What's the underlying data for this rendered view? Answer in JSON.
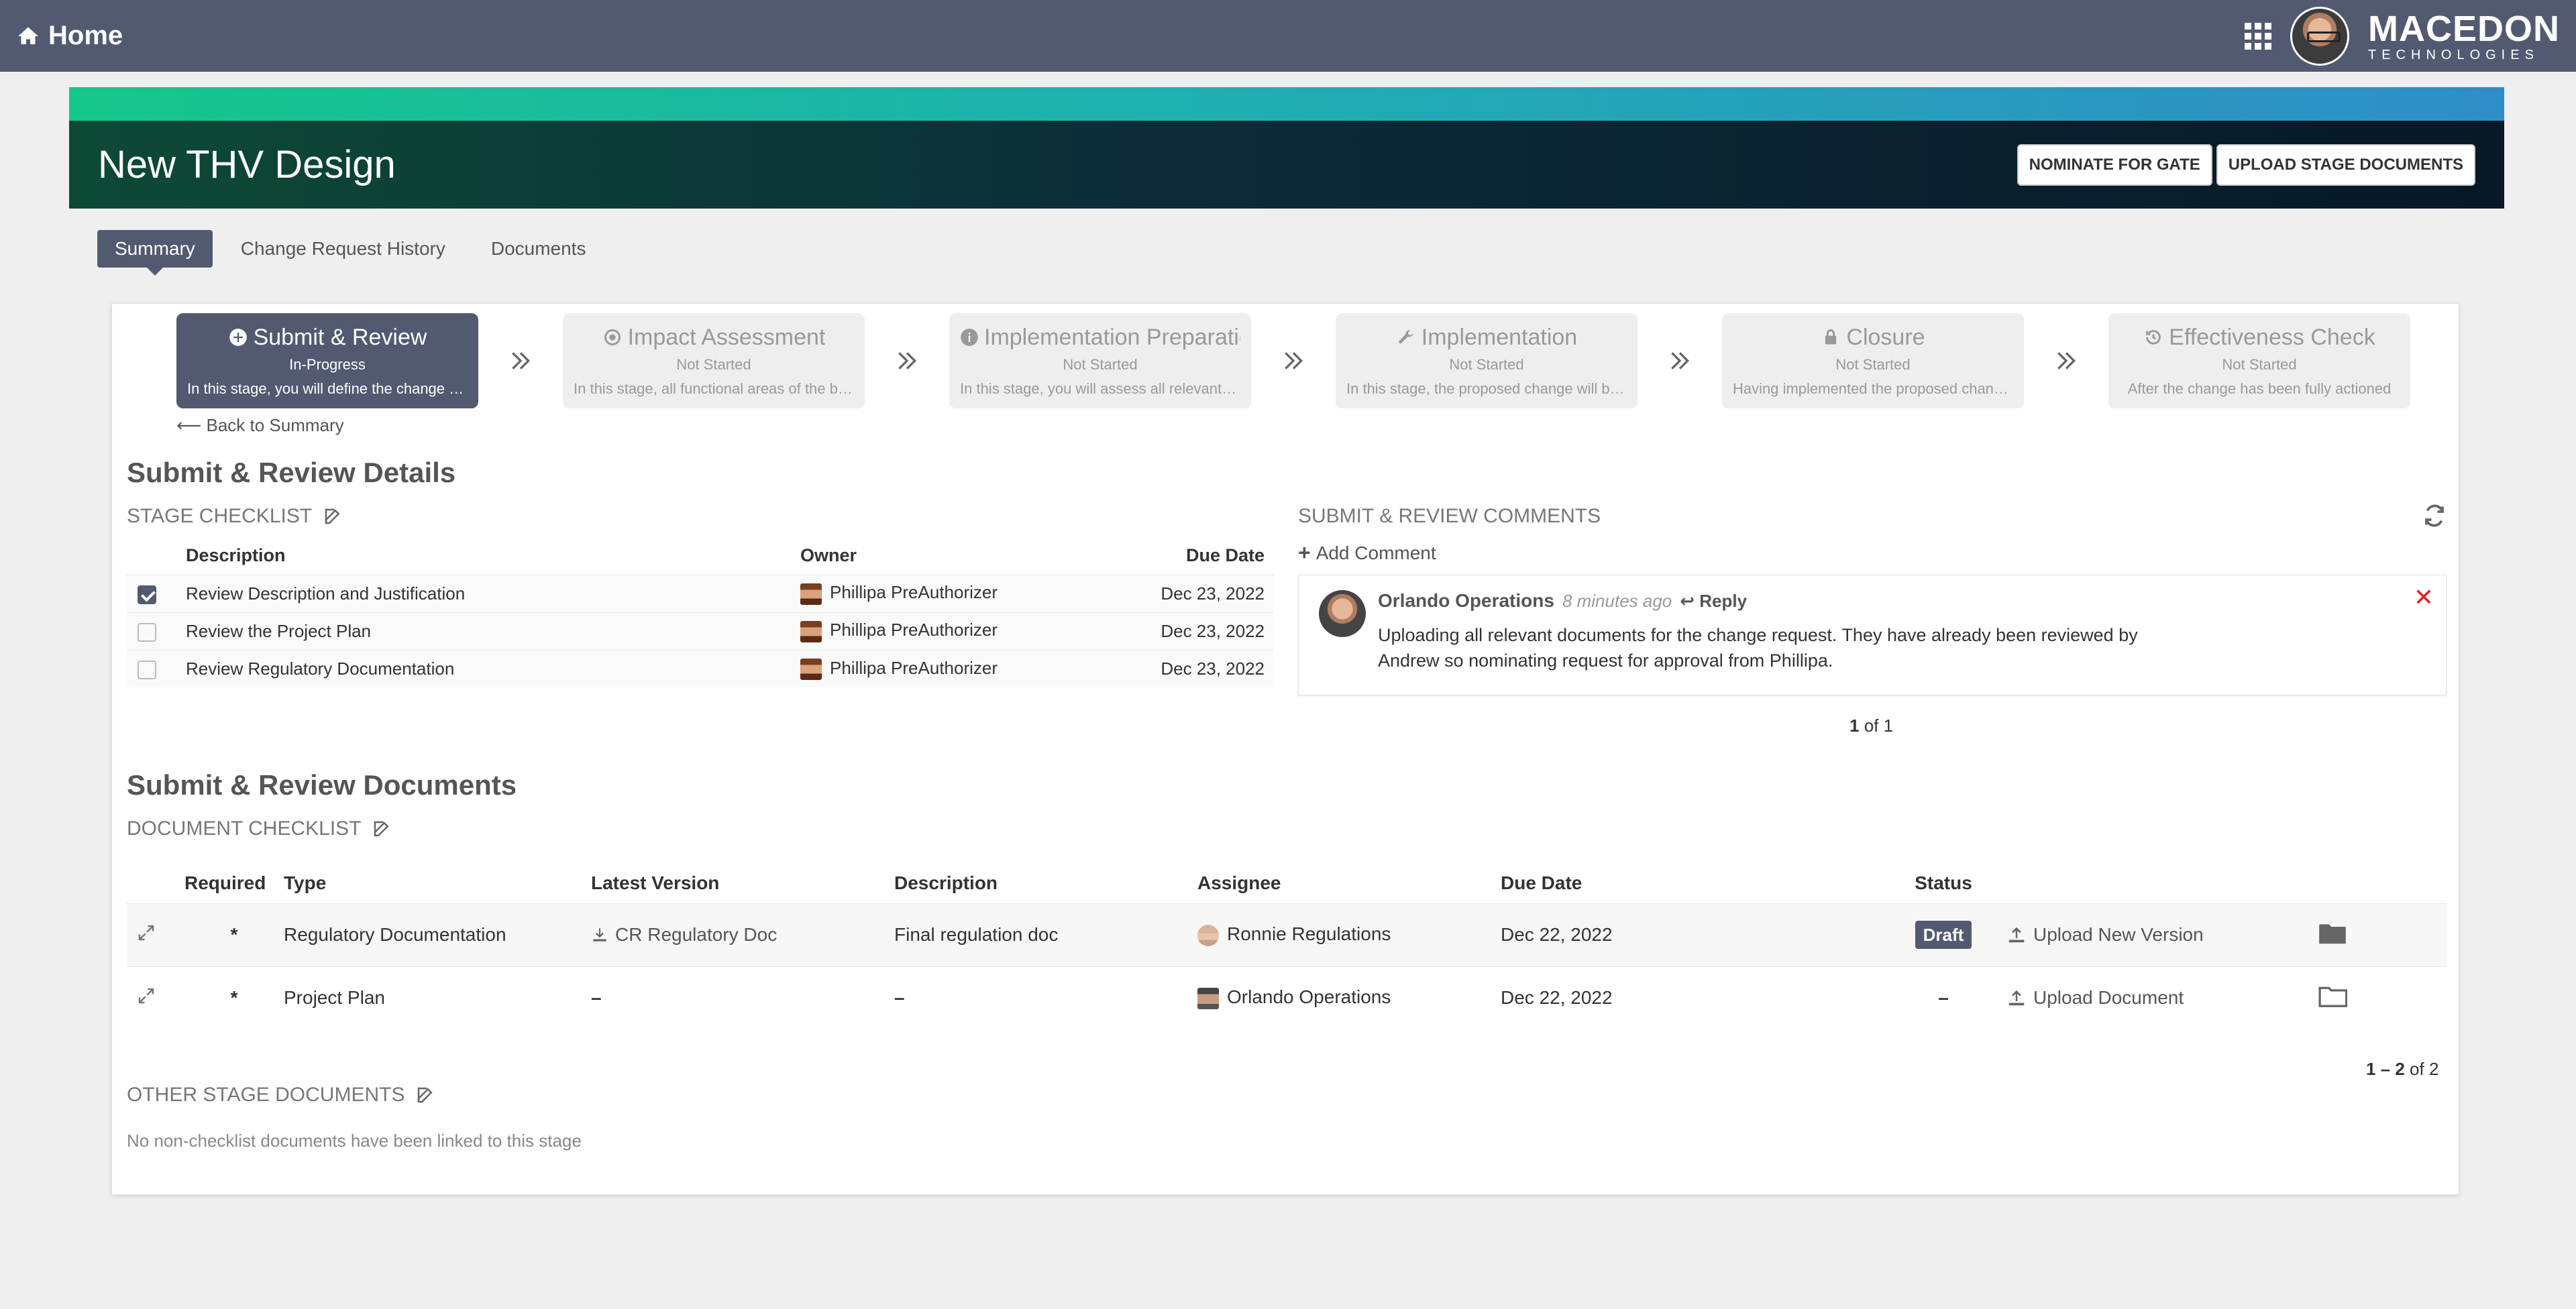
{
  "nav": {
    "home_label": "Home",
    "logo_main": "MACEDON",
    "logo_sub": "TECHNOLOGIES"
  },
  "banner": {
    "title": "New THV Design",
    "nominate_label": "NOMINATE FOR GATE",
    "upload_label": "UPLOAD STAGE DOCUMENTS"
  },
  "tabs": [
    {
      "label": "Summary"
    },
    {
      "label": "Change Request History"
    },
    {
      "label": "Documents"
    }
  ],
  "stages": [
    {
      "name": "Submit & Review",
      "status": "In-Progress",
      "desc": "In this stage, you will define the change request",
      "icon": "plus-circle-icon"
    },
    {
      "name": "Impact Assessment",
      "status": "Not Started",
      "desc": "In this stage, all functional areas of the business",
      "icon": "dot-circle-icon"
    },
    {
      "name": "Implementation Preparation",
      "status": "Not Started",
      "desc": "In this stage, you will assess all relevant risks",
      "icon": "info-circle-icon"
    },
    {
      "name": "Implementation",
      "status": "Not Started",
      "desc": "In this stage, the proposed change will be implemented",
      "icon": "wrench-icon"
    },
    {
      "name": "Closure",
      "status": "Not Started",
      "desc": "Having implemented the proposed change request",
      "icon": "lock-icon"
    },
    {
      "name": "Effectiveness Check",
      "status": "Not Started",
      "desc": "After the change has been fully actioned",
      "icon": "history-icon"
    }
  ],
  "back_label": "Back to Summary",
  "details": {
    "title": "Submit & Review Details",
    "checklist_label": "STAGE CHECKLIST",
    "headers": {
      "description": "Description",
      "owner": "Owner",
      "due": "Due Date"
    },
    "rows": [
      {
        "checked": true,
        "description": "Review Description and Justification",
        "owner": "Phillipa PreAuthorizer",
        "due": "Dec 23, 2022"
      },
      {
        "checked": false,
        "description": "Review the Project Plan",
        "owner": "Phillipa PreAuthorizer",
        "due": "Dec 23, 2022"
      },
      {
        "checked": false,
        "description": "Review Regulatory Documentation",
        "owner": "Phillipa PreAuthorizer",
        "due": "Dec 23, 2022"
      }
    ]
  },
  "comments": {
    "label": "SUBMIT & REVIEW COMMENTS",
    "add_label": "Add Comment",
    "items": [
      {
        "author": "Orlando Operations",
        "time": "8 minutes ago",
        "reply": "Reply",
        "text": "Uploading all relevant documents for the change request. They have already been reviewed by Andrew so nominating request for approval from Phillipa."
      }
    ],
    "pager_current": "1",
    "pager_rest": " of 1"
  },
  "documents": {
    "title": "Submit & Review Documents",
    "checklist_label": "DOCUMENT CHECKLIST",
    "headers": {
      "required": "Required",
      "type": "Type",
      "latest": "Latest Version",
      "description": "Description",
      "assignee": "Assignee",
      "due": "Due Date",
      "status": "Status"
    },
    "rows": [
      {
        "required": "*",
        "type": "Regulatory Documentation",
        "latest": "CR Regulatory Doc",
        "description": "Final regulation doc",
        "assignee": "Ronnie Regulations",
        "due": "Dec 22, 2022",
        "status": "Draft",
        "action": "Upload New Version"
      },
      {
        "required": "*",
        "type": "Project Plan",
        "latest": "–",
        "description": "–",
        "assignee": "Orlando Operations",
        "due": "Dec 22, 2022",
        "status": "–",
        "action": "Upload Document"
      }
    ],
    "pager_current": "1 – 2",
    "pager_rest": " of 2"
  },
  "other": {
    "label": "OTHER STAGE DOCUMENTS",
    "empty": "No non-checklist documents have been linked to this stage"
  },
  "colors": {
    "nav": "#525a72",
    "accent": "#525a72",
    "danger": "#e02020"
  }
}
